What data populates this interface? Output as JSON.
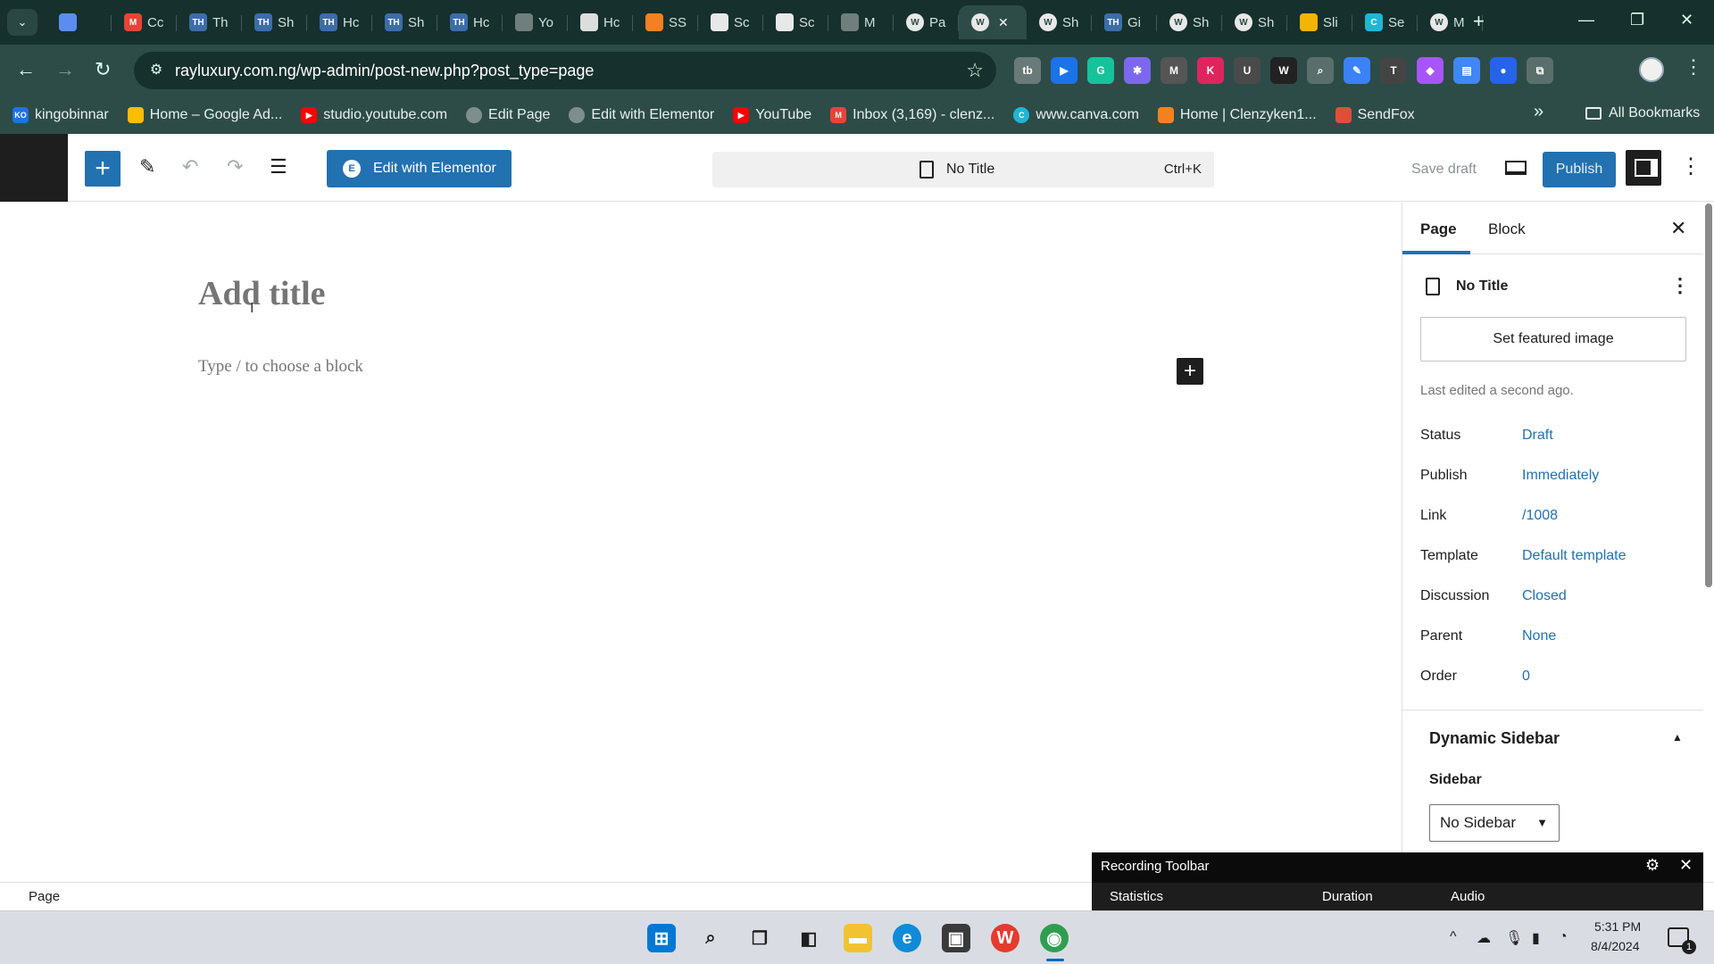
{
  "browser": {
    "tabs": [
      {
        "label": "",
        "icon": "map-pin-icon",
        "color": "#5b8def",
        "glyph": ""
      },
      {
        "label": "Cc",
        "icon": "gmail-icon",
        "color": "#ea4335",
        "glyph": "M"
      },
      {
        "label": "Th",
        "icon": "th-icon",
        "color": "#3b6ea8",
        "glyph": "TH"
      },
      {
        "label": "Sh",
        "icon": "th-icon",
        "color": "#3b6ea8",
        "glyph": "TH"
      },
      {
        "label": "Hc",
        "icon": "th-icon",
        "color": "#3b6ea8",
        "glyph": "TH"
      },
      {
        "label": "Sh",
        "icon": "th-icon",
        "color": "#3b6ea8",
        "glyph": "TH"
      },
      {
        "label": "Hc",
        "icon": "th-icon",
        "color": "#3b6ea8",
        "glyph": "TH"
      },
      {
        "label": "Yo",
        "icon": "globe-icon",
        "color": "#6f7f7c",
        "glyph": ""
      },
      {
        "label": "Hc",
        "icon": "circle-icon",
        "color": "#dddddd",
        "glyph": ""
      },
      {
        "label": "SS",
        "icon": "cloud-icon",
        "color": "#f48120",
        "glyph": ""
      },
      {
        "label": "Sc",
        "icon": "chart-icon",
        "color": "#e8e8e8",
        "glyph": ""
      },
      {
        "label": "Sc",
        "icon": "chart-icon",
        "color": "#e8e8e8",
        "glyph": ""
      },
      {
        "label": "M",
        "icon": "globe-icon",
        "color": "#6f7f7c",
        "glyph": ""
      },
      {
        "label": "Pa",
        "icon": "wordpress-icon",
        "color": "#e8e8e8",
        "glyph": "W"
      },
      {
        "label": "",
        "icon": "wordpress-icon",
        "color": "#e8e8e8",
        "glyph": "W",
        "active": true
      },
      {
        "label": "Sh",
        "icon": "wordpress-icon",
        "color": "#e8e8e8",
        "glyph": "W"
      },
      {
        "label": "Gi",
        "icon": "th-icon",
        "color": "#3b6ea8",
        "glyph": "TH"
      },
      {
        "label": "Sh",
        "icon": "wordpress-icon",
        "color": "#e8e8e8",
        "glyph": "W"
      },
      {
        "label": "Sh",
        "icon": "wordpress-icon",
        "color": "#e8e8e8",
        "glyph": "W"
      },
      {
        "label": "Sli",
        "icon": "slides-icon",
        "color": "#f4b400",
        "glyph": ""
      },
      {
        "label": "Se",
        "icon": "canva-icon",
        "color": "#1fb6d6",
        "glyph": "C"
      },
      {
        "label": "M",
        "icon": "wordpress-icon",
        "color": "#e8e8e8",
        "glyph": "W"
      }
    ],
    "url": "rayluxury.com.ng/wp-admin/post-new.php?post_type=page",
    "extensions": [
      {
        "name": "extension-tb-icon",
        "color": "#6a7a78",
        "glyph": "tb"
      },
      {
        "name": "extension-play-icon",
        "color": "#1a73e8",
        "glyph": "▶"
      },
      {
        "name": "grammarly-icon",
        "color": "#15c39a",
        "glyph": "G"
      },
      {
        "name": "extension-asterisk-icon",
        "color": "#7b68ee",
        "glyph": "✱"
      },
      {
        "name": "extension-m-icon",
        "color": "#555555",
        "glyph": "M"
      },
      {
        "name": "extension-k-icon",
        "color": "#e0245e",
        "glyph": "K"
      },
      {
        "name": "extension-u-icon",
        "color": "#4a4a4a",
        "glyph": "U"
      },
      {
        "name": "extension-w-icon",
        "color": "#222222",
        "glyph": "W"
      },
      {
        "name": "extension-search-icon",
        "color": "#5a6f6c",
        "glyph": "⌕"
      },
      {
        "name": "extension-pen-icon",
        "color": "#3b82f6",
        "glyph": "✎"
      },
      {
        "name": "extension-t-icon",
        "color": "#444444",
        "glyph": "T"
      },
      {
        "name": "extension-gem-icon",
        "color": "#a855f7",
        "glyph": "◆"
      },
      {
        "name": "extension-docs-icon",
        "color": "#4285f4",
        "glyph": "▤"
      },
      {
        "name": "extension-pin-icon",
        "color": "#2563eb",
        "glyph": "●"
      },
      {
        "name": "extensions-puzzle-icon",
        "color": "#5a6f6c",
        "glyph": "⧉"
      }
    ],
    "bookmarks": [
      {
        "label": "kingobinnar",
        "icon": "ko-icon",
        "color": "#1a73e8",
        "glyph": "KO"
      },
      {
        "label": "Home – Google Ad...",
        "icon": "google-ads-icon",
        "color": "#fbbc04",
        "glyph": ""
      },
      {
        "label": "studio.youtube.com",
        "icon": "youtube-icon",
        "color": "#ff0000",
        "glyph": "▶"
      },
      {
        "label": "Edit Page",
        "icon": "globe-icon",
        "color": "#7d8f8c",
        "glyph": ""
      },
      {
        "label": "Edit with Elementor",
        "icon": "globe-icon",
        "color": "#7d8f8c",
        "glyph": ""
      },
      {
        "label": "YouTube",
        "icon": "youtube-icon",
        "color": "#ff0000",
        "glyph": "▶"
      },
      {
        "label": "Inbox (3,169) - clenz...",
        "icon": "gmail-icon",
        "color": "#ea4335",
        "glyph": "M"
      },
      {
        "label": "www.canva.com",
        "icon": "canva-icon",
        "color": "#1fb6d6",
        "glyph": "C"
      },
      {
        "label": "Home | Clenzyken1...",
        "icon": "cloud-icon",
        "color": "#f48120",
        "glyph": ""
      },
      {
        "label": "SendFox",
        "icon": "sendfox-icon",
        "color": "#e04e39",
        "glyph": ""
      }
    ],
    "all_bookmarks": "All Bookmarks"
  },
  "editor": {
    "edit_with_elementor": "Edit with Elementor",
    "document_title": "No Title",
    "shortcut": "Ctrl+K",
    "save_draft": "Save draft",
    "publish": "Publish",
    "title_placeholder": "Add title",
    "block_placeholder": "Type / to choose a block",
    "breadcrumb": "Page"
  },
  "sidebar": {
    "tabs": [
      "Page",
      "Block"
    ],
    "doc_title": "No Title",
    "featured_image": "Set featured image",
    "last_edited": "Last edited a second ago.",
    "meta": [
      {
        "label": "Status",
        "value": "Draft"
      },
      {
        "label": "Publish",
        "value": "Immediately"
      },
      {
        "label": "Link",
        "value": "/1008"
      },
      {
        "label": "Template",
        "value": "Default template"
      },
      {
        "label": "Discussion",
        "value": "Closed"
      },
      {
        "label": "Parent",
        "value": "None"
      },
      {
        "label": "Order",
        "value": "0"
      }
    ],
    "dynamic_sidebar": {
      "title": "Dynamic Sidebar",
      "label": "Sidebar",
      "selected": "No Sidebar"
    }
  },
  "recording": {
    "title": "Recording Toolbar",
    "columns": [
      "Statistics",
      "Duration",
      "Audio"
    ]
  },
  "taskbar": {
    "time": "5:31 PM",
    "date": "8/4/2024",
    "notifications": "1"
  },
  "colors": {
    "wp_blue": "#2271b1",
    "chrome_dark": "#16302d",
    "chrome_toolbar": "#2d4c48"
  }
}
